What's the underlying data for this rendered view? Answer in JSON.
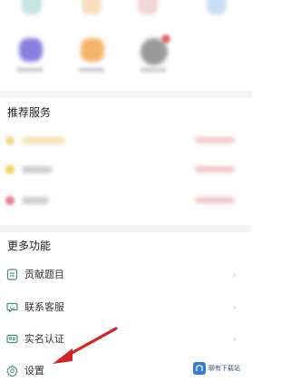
{
  "colors": {
    "accent_arrow": "#d32525",
    "divider": "#f4f4f6",
    "icon_line": "#4a8c7a",
    "watermark_badge": "#3a7bd5"
  },
  "sections": {
    "recommended_title": "推荐服务",
    "more_title": "更多功能"
  },
  "more_items": [
    {
      "label": "贡献题目",
      "icon": "list-doc-icon"
    },
    {
      "label": "联系客服",
      "icon": "chat-bubble-icon"
    },
    {
      "label": "实名认证",
      "icon": "id-card-icon"
    },
    {
      "label": "设置",
      "icon": "gear-icon"
    }
  ],
  "watermark": {
    "text": "聊有下载站"
  }
}
